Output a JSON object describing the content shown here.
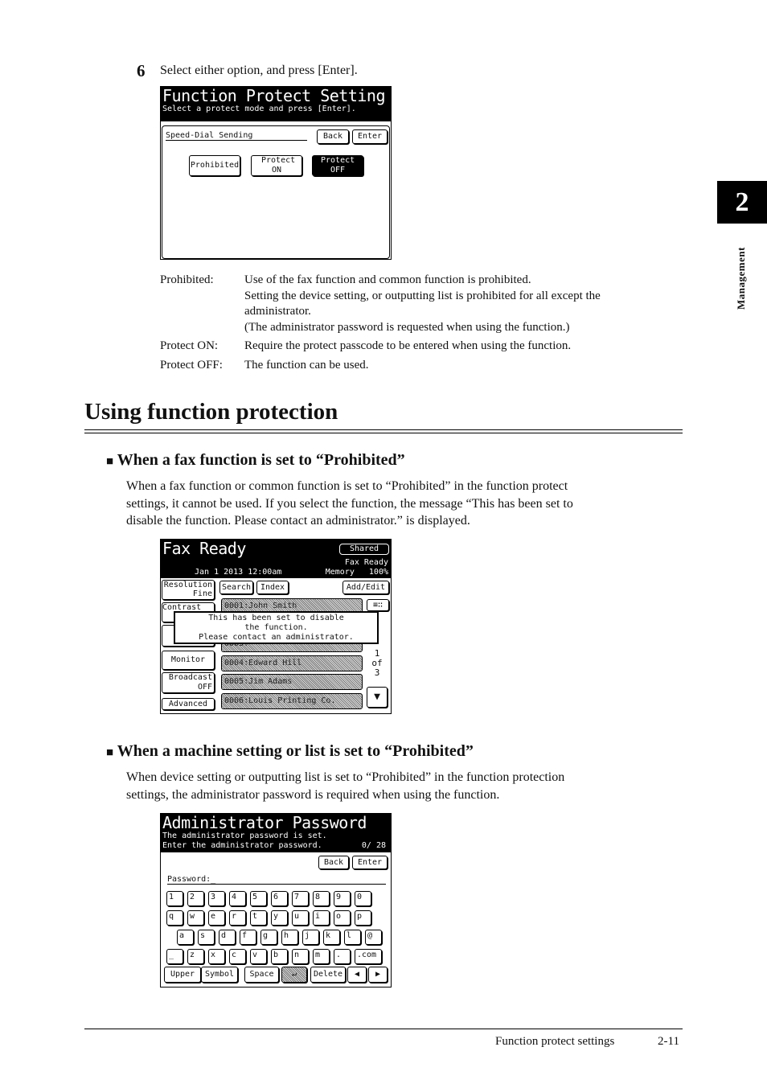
{
  "step": {
    "number": "6",
    "text": "Select either option, and press [Enter]."
  },
  "screen1": {
    "title": "Function Protect Setting",
    "subtitle": "Select a protect mode and press [Enter].",
    "field": "Speed-Dial Sending",
    "back": "Back",
    "enter": "Enter",
    "options": [
      "Prohibited",
      "Protect ON",
      "Protect OFF"
    ],
    "selected": "Protect OFF"
  },
  "definitions": [
    {
      "term": "Prohibited:",
      "lines": [
        "Use of the fax function and common function is prohibited.",
        "Setting the device setting, or outputting list is prohibited for all except the",
        "administrator.",
        "(The administrator password is requested when using the function.)"
      ]
    },
    {
      "term": "Protect ON:",
      "lines": [
        "Require the protect passcode to be entered when using the function."
      ]
    },
    {
      "term": "Protect OFF:",
      "lines": [
        "The function can be used."
      ]
    }
  ],
  "section": {
    "title": "Using function protection"
  },
  "sub1": {
    "title": "When a fax function is set to “Prohibited”",
    "lines": [
      "When a fax function or common function is set to “Prohibited” in the function protect",
      "settings, it cannot be used.  If you select the function, the message “This has been set to",
      "disable the function.  Please contact an administrator.” is displayed."
    ]
  },
  "screen2": {
    "title": "Fax Ready",
    "shared": "Shared",
    "status": "Fax Ready",
    "date": "Jan  1 2013 12:00am",
    "memory": "Memory   100%",
    "left": [
      "Resolution\nFine",
      "Contrast",
      "",
      "",
      "Monitor",
      "Broadcast\nOFF",
      "Advanced"
    ],
    "search": "Search",
    "index": "Index",
    "addedit": "Add/Edit",
    "entries": [
      "0001:John Smith",
      "0002:",
      "0003:",
      "0004:Edward Hill",
      "0005:Jim Adams",
      "0006:Louis Printing Co."
    ],
    "page": [
      "1",
      "of",
      "3"
    ],
    "message": [
      "This has been set to disable",
      "the function.",
      "Please contact an administrator."
    ]
  },
  "sub2": {
    "title": "When a machine setting or list is set to “Prohibited”",
    "lines": [
      "When device setting or outputting list is set to “Prohibited” in the function protection",
      "settings, the administrator password is required when using the function."
    ]
  },
  "screen3": {
    "title": "Administrator Password",
    "line1": "The administrator password is set.",
    "line2": "Enter the administrator password.",
    "count": "0/ 28",
    "back": "Back",
    "enter": "Enter",
    "label": "Password:_",
    "rows": [
      [
        "1",
        "2",
        "3",
        "4",
        "5",
        "6",
        "7",
        "8",
        "9",
        "0"
      ],
      [
        "q",
        "w",
        "e",
        "r",
        "t",
        "y",
        "u",
        "i",
        "o",
        "p"
      ],
      [
        "a",
        "s",
        "d",
        "f",
        "g",
        "h",
        "j",
        "k",
        "l",
        "@"
      ],
      [
        "_",
        "z",
        "x",
        "c",
        "v",
        "b",
        "n",
        "m",
        ".",
        ".com"
      ]
    ],
    "bottom": [
      "Upper",
      "Symbol",
      "Space",
      "↵",
      "Delete",
      "◀",
      "▶"
    ]
  },
  "chapter": {
    "number": "2",
    "label": "Management"
  },
  "footer": {
    "title": "Function protect settings",
    "page": "2-11"
  }
}
